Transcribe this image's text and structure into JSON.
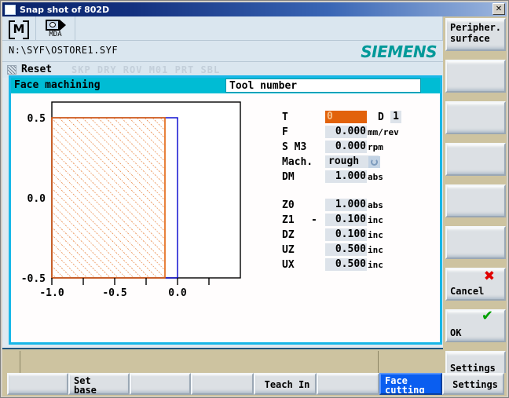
{
  "window": {
    "title": "Snap shot of 802D",
    "close_label": "✕",
    "icon": "window-icon"
  },
  "toolbar": {
    "mode_icon_label": "M",
    "mda_label": "MDA"
  },
  "path": {
    "text": "N:\\SYF\\OSTORE1.SYF"
  },
  "brand": {
    "text": "SIEMENS",
    "color": "#009999"
  },
  "status": {
    "reset": "Reset",
    "flags": "SKP DRY ROV M01 PRT SBL"
  },
  "dialog": {
    "title": "Face machining",
    "subtitle": "Tool number",
    "accent": "#00bcd4"
  },
  "chart_data": {
    "type": "area",
    "title": "",
    "xlabel": "",
    "ylabel": "",
    "xlim": [
      -1.2,
      0.4
    ],
    "ylim": [
      -0.62,
      0.62
    ],
    "xticks": [
      -1.0,
      -0.75,
      -0.5,
      -0.25,
      0.0,
      0.25
    ],
    "xtick_labels": [
      "-1.0",
      "",
      "-0.5",
      "",
      "0.0",
      ""
    ],
    "yticks": [
      0.5,
      0.0,
      -0.5
    ],
    "ytick_labels": [
      "0.5",
      "0.0",
      "-0.5"
    ],
    "grid": false,
    "legend": "none",
    "shapes": [
      {
        "name": "blank-outline",
        "kind": "rect",
        "x0": -1.0,
        "y0": -0.5,
        "x1": 0.0,
        "y1": 0.5,
        "stroke": "#0000cc",
        "fill": "none"
      },
      {
        "name": "machining-area-hatched",
        "kind": "rect",
        "x0": -1.0,
        "y0": -0.5,
        "x1": -0.1,
        "y1": 0.5,
        "stroke": "#e2620b",
        "fill": "hatch45",
        "hatch_color": "#e2620b"
      }
    ]
  },
  "form": {
    "rows": [
      {
        "label": "T",
        "value": "0",
        "unit": "",
        "selected": true,
        "has_d": true,
        "d_label": "D",
        "d_value": "1"
      },
      {
        "label": "F",
        "value": "0.000",
        "unit": "mm/rev",
        "selected": false,
        "has_d": false
      },
      {
        "label": "S M3",
        "value": "0.000",
        "unit": "rpm",
        "selected": false,
        "has_d": false
      },
      {
        "label": "Mach.",
        "value": "rough",
        "unit": "",
        "selected": false,
        "combo": true,
        "has_d": false
      },
      {
        "label": "DM",
        "value": "1.000",
        "unit": "abs",
        "selected": false,
        "has_d": false
      }
    ],
    "rows2": [
      {
        "label": "Z0",
        "value": "1.000",
        "unit": "abs",
        "minus": ""
      },
      {
        "label": "Z1",
        "value": "0.100",
        "unit": "inc",
        "minus": "-"
      },
      {
        "label": "DZ",
        "value": "0.100",
        "unit": "inc",
        "minus": ""
      },
      {
        "label": "UZ",
        "value": "0.500",
        "unit": "inc",
        "minus": ""
      },
      {
        "label": "UX",
        "value": "0.500",
        "unit": "inc",
        "minus": ""
      }
    ]
  },
  "vertical_softkeys": [
    {
      "label": "Peripher.\nsurface",
      "line1": "Peripher.",
      "line2": "surface",
      "icon": ""
    },
    {
      "label": "",
      "line1": "",
      "line2": "",
      "icon": ""
    },
    {
      "label": "",
      "line1": "",
      "line2": "",
      "icon": ""
    },
    {
      "label": "",
      "line1": "",
      "line2": "",
      "icon": ""
    },
    {
      "label": "",
      "line1": "",
      "line2": "",
      "icon": ""
    },
    {
      "label": "",
      "line1": "",
      "line2": "",
      "icon": ""
    },
    {
      "label": "Cancel",
      "line1": "",
      "line2": "Cancel",
      "icon": "red-x-icon",
      "glyph": "✖"
    },
    {
      "label": "OK",
      "line1": "",
      "line2": "OK",
      "icon": "green-check-icon",
      "glyph": "✔"
    },
    {
      "label": "Settings",
      "line1": "",
      "line2": "Settings",
      "icon": ""
    }
  ],
  "horizontal_softkeys": [
    {
      "line1": "",
      "line2": "",
      "active": false
    },
    {
      "line1": "Set",
      "line2": "base",
      "active": false
    },
    {
      "line1": "",
      "line2": "",
      "active": false
    },
    {
      "line1": "",
      "line2": "",
      "active": false
    },
    {
      "line1": "Teach In",
      "line2": "",
      "active": false
    },
    {
      "line1": "",
      "line2": "",
      "active": false
    },
    {
      "line1": "Face",
      "line2": "cutting",
      "active": true
    },
    {
      "line1": "Settings",
      "line2": "",
      "active": false
    }
  ]
}
